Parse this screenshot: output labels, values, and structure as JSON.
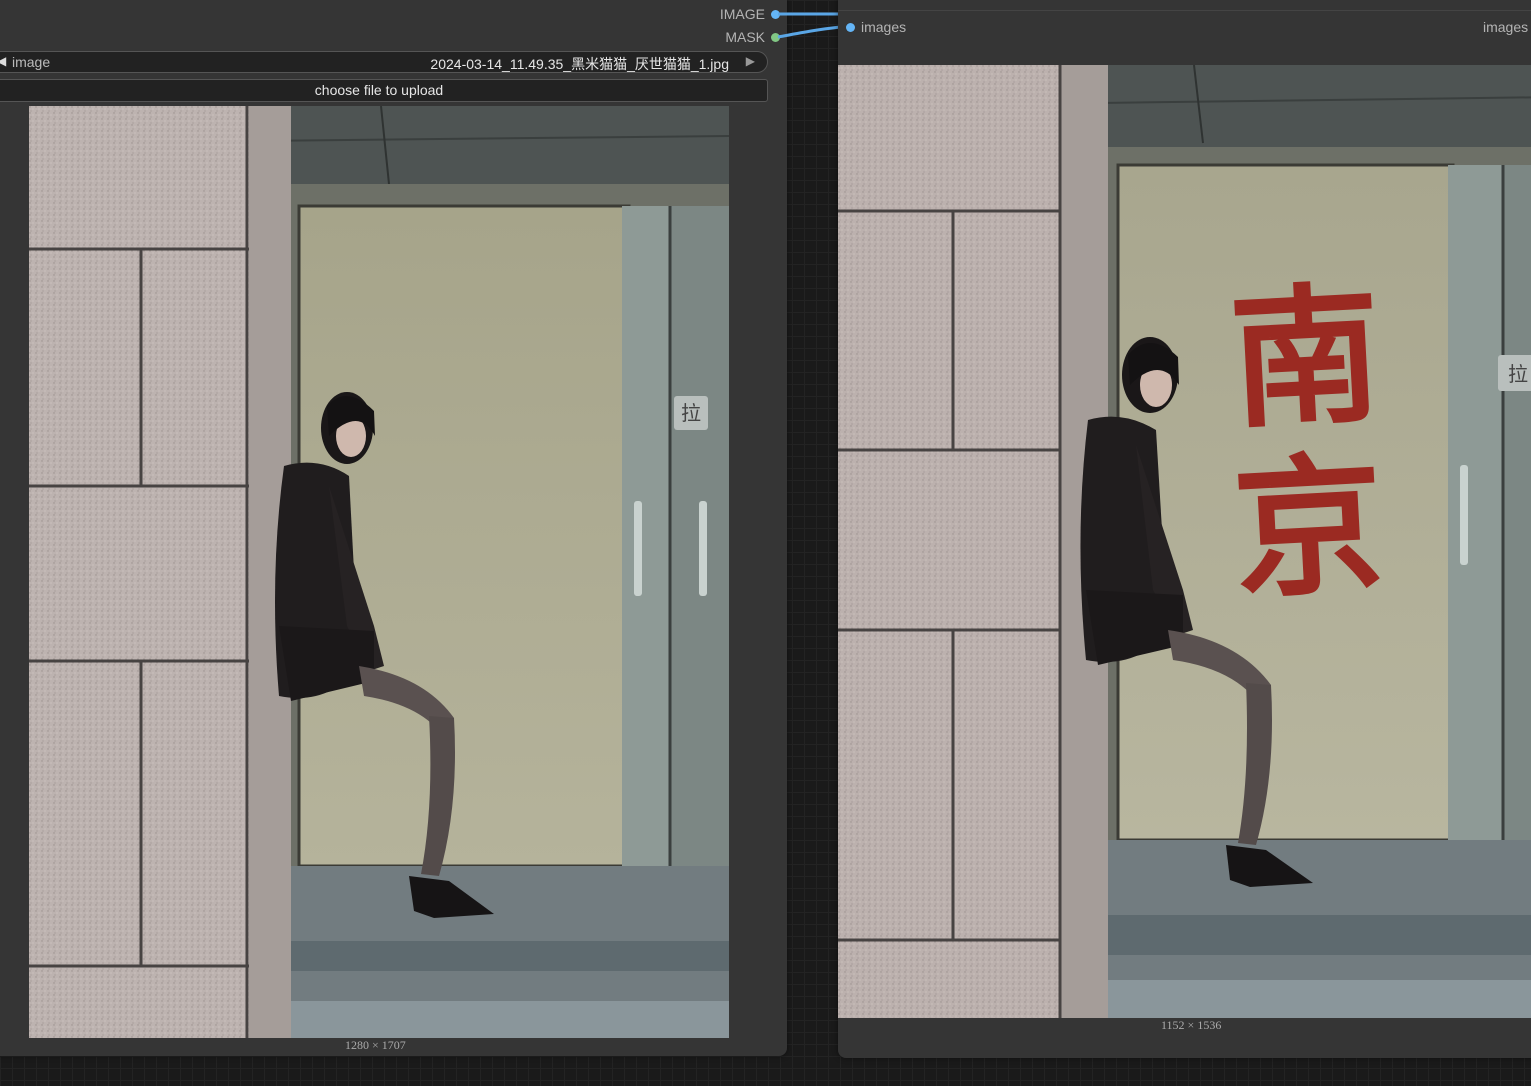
{
  "load_image_node": {
    "outputs": [
      {
        "label": "IMAGE",
        "color": "#64b5f6"
      },
      {
        "label": "MASK",
        "color": "#81c784"
      }
    ],
    "image_widget": {
      "name": "image",
      "value": "2024-03-14_11.49.35_黑米猫猫_厌世猫猫_1.jpg"
    },
    "upload_button": "choose file to upload",
    "preview_dimensions": "1280 × 1707",
    "door_sign": "拉"
  },
  "preview_node": {
    "input": {
      "label": "images",
      "color": "#64b5f6"
    },
    "output_label": "images",
    "preview_dimensions": "1152 × 1536",
    "painted_text": [
      "南",
      "京"
    ],
    "door_sign": "拉"
  },
  "link_color": "#5aa6e6"
}
